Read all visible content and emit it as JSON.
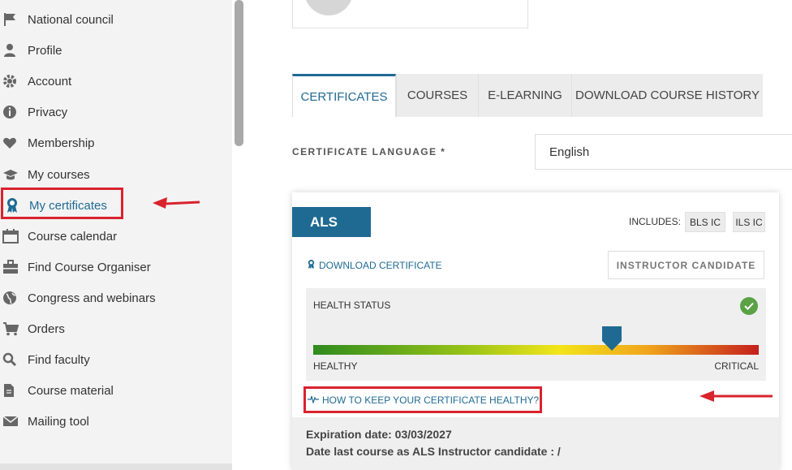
{
  "sidebar": {
    "items": [
      {
        "label": "National council",
        "icon": "flag-icon"
      },
      {
        "label": "Profile",
        "icon": "user-icon"
      },
      {
        "label": "Account",
        "icon": "gear-icon"
      },
      {
        "label": "Privacy",
        "icon": "info-icon"
      },
      {
        "label": "Membership",
        "icon": "heart-icon"
      },
      {
        "label": "My courses",
        "icon": "graduation-cap-icon"
      },
      {
        "label": "My certificates",
        "icon": "ribbon-icon"
      },
      {
        "label": "Course calendar",
        "icon": "calendar-icon"
      },
      {
        "label": "Find Course Organiser",
        "icon": "briefcase-icon"
      },
      {
        "label": "Congress and webinars",
        "icon": "globe-icon"
      },
      {
        "label": "Orders",
        "icon": "cart-icon"
      },
      {
        "label": "Find faculty",
        "icon": "search-icon"
      },
      {
        "label": "Course material",
        "icon": "document-icon"
      },
      {
        "label": "Mailing tool",
        "icon": "envelope-icon"
      }
    ],
    "active": "My certificates"
  },
  "tabs": [
    {
      "label": "CERTIFICATES",
      "active": true
    },
    {
      "label": "COURSES",
      "active": false
    },
    {
      "label": "E-LEARNING",
      "active": false
    },
    {
      "label": "DOWNLOAD COURSE HISTORY",
      "active": false
    }
  ],
  "certificate_language": {
    "label": "CERTIFICATE LANGUAGE *",
    "value": "English"
  },
  "certificate": {
    "name": "ALS",
    "includes_label": "INCLUDES:",
    "includes": [
      "BLS IC",
      "ILS IC"
    ],
    "download_label": "DOWNLOAD CERTIFICATE",
    "role_badge": "INSTRUCTOR CANDIDATE",
    "health": {
      "title": "HEALTH STATUS",
      "left_label": "HEALTHY",
      "right_label": "CRITICAL",
      "level": 0.67
    },
    "keep_healthy_label": "HOW TO KEEP YOUR CERTIFICATE HEALTHY?",
    "expiration": "Expiration date: 03/03/2027",
    "last_course": "Date last course as ALS Instructor candidate : /"
  },
  "colors": {
    "accent": "#1f6a93",
    "highlight": "#d9232d",
    "ok": "#5aa245"
  }
}
